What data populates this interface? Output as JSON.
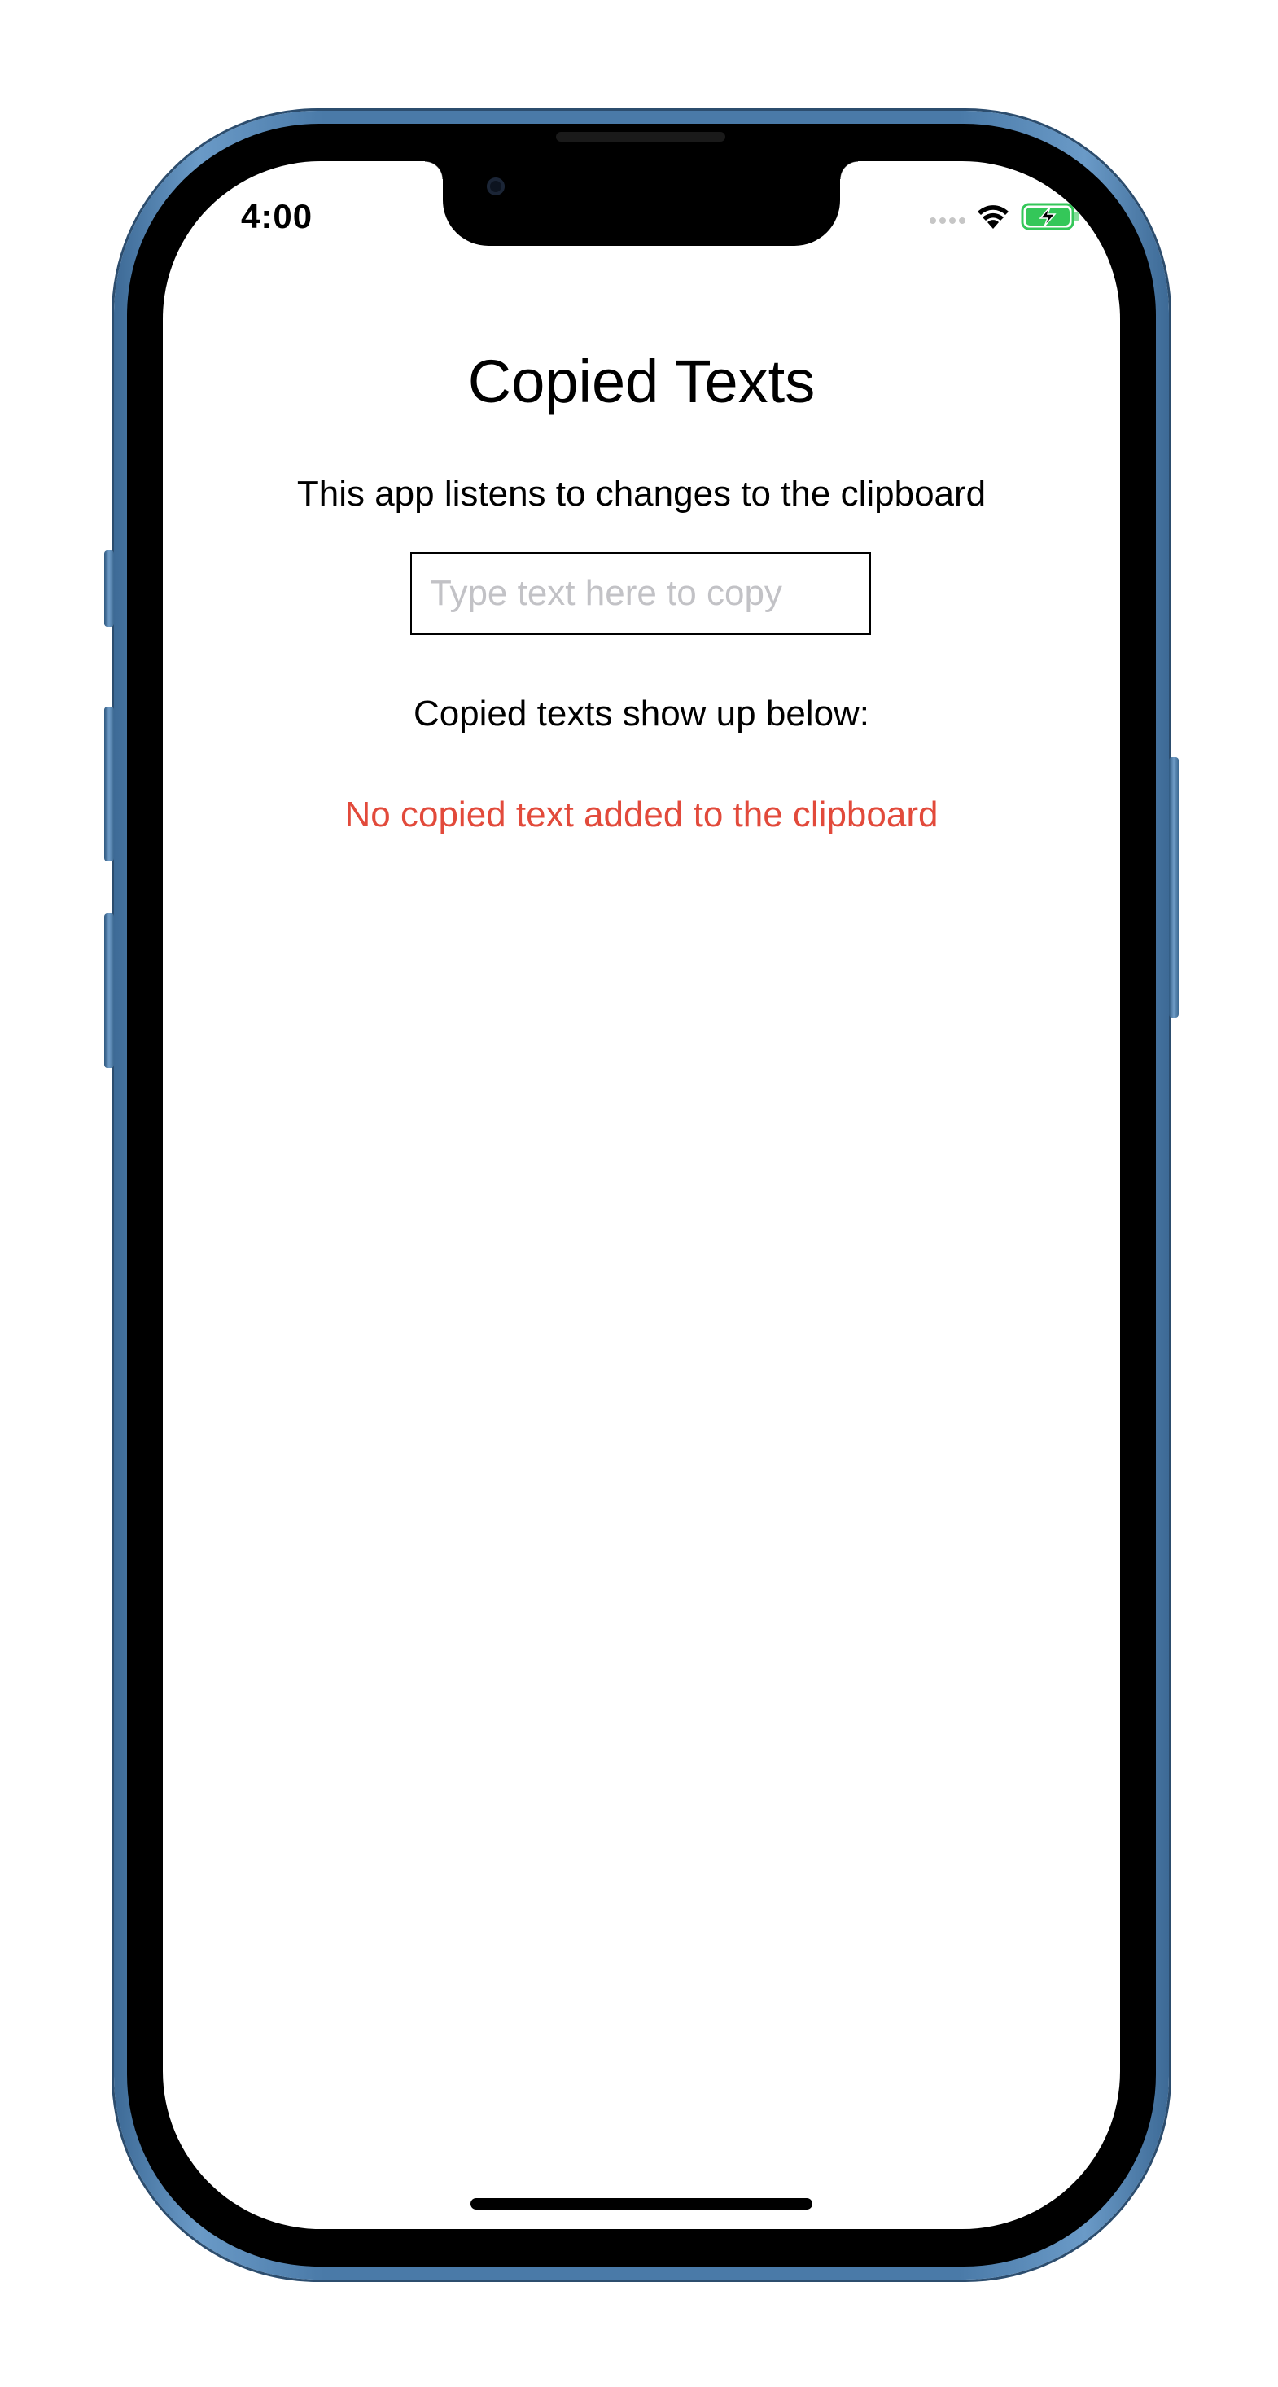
{
  "status_bar": {
    "time": "4:00",
    "icons": [
      "cellular-signal-icon",
      "wifi-icon",
      "battery-charging-icon"
    ],
    "battery_color": "#34c759"
  },
  "app": {
    "title": "Copied Texts",
    "subtitle": "This app listens to changes to the clipboard",
    "input": {
      "placeholder": "Type text here to copy",
      "value": ""
    },
    "list_label": "Copied texts show up below:",
    "empty_message": "No copied text added to the clipboard",
    "empty_message_color": "#e24a3b"
  },
  "device": {
    "frame_color": "#4a7aa8"
  }
}
